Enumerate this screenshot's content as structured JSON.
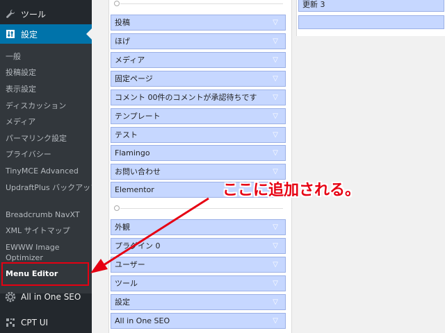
{
  "sidebar": {
    "tools_label": "ツール",
    "settings_label": "設定",
    "submenu": [
      "一般",
      "投稿設定",
      "表示設定",
      "ディスカッション",
      "メディア",
      "パーマリンク設定",
      "プライバシー",
      "TinyMCE Advanced",
      "UpdraftPlus バックアップ",
      "Breadcrumb NavXT",
      "XML サイトマップ",
      "EWWW Image Optimizer",
      "Menu Editor"
    ],
    "aioseo_label": "All in One SEO",
    "cptui_label": "CPT UI"
  },
  "menu_items_top": [
    "投稿",
    "ほげ",
    "メディア",
    "固定ページ",
    "コメント 00件のコメントが承認待ちです",
    "テンプレート",
    "テスト",
    "Flamingo",
    "お問い合わせ",
    "Elementor"
  ],
  "menu_items_bottom": [
    "外観",
    "プラグイン 0",
    "ユーザー",
    "ツール",
    "設定",
    "All in One SEO"
  ],
  "right_panel": {
    "item_label": "更新 3"
  },
  "annotation": {
    "text": "ここに追加される。",
    "color": "#e60012"
  },
  "colors": {
    "sidebar_bg": "#23282d",
    "active_menu": "#0073aa",
    "menu_item_bg": "#c6d7ff"
  }
}
